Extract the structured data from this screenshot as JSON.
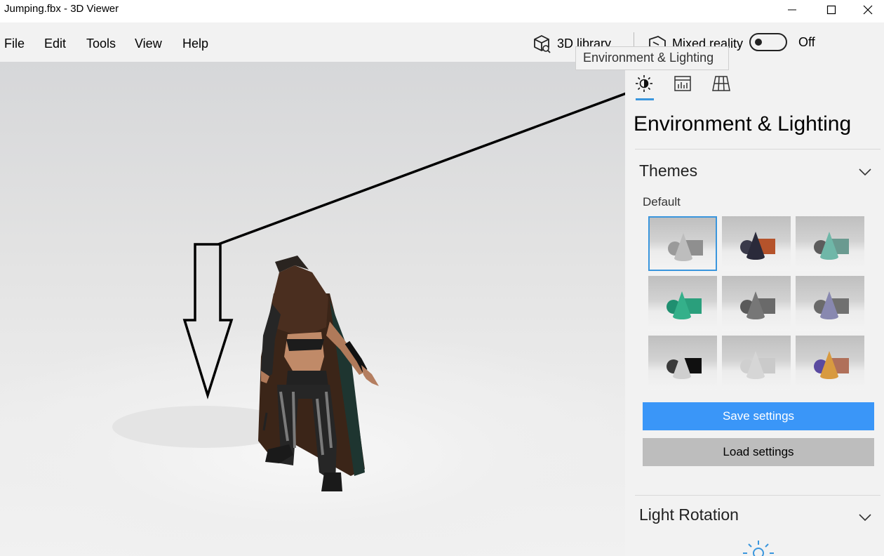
{
  "window": {
    "title": "Jumping.fbx - 3D Viewer"
  },
  "menu": [
    "File",
    "Edit",
    "Tools",
    "View",
    "Help"
  ],
  "toolbar": {
    "library_label": "3D library",
    "mixed_reality_label": "Mixed reality",
    "mixed_reality_state": "Off"
  },
  "tooltip": "Environment & Lighting",
  "panel": {
    "title": "Environment & Lighting",
    "themes": {
      "heading": "Themes",
      "group_label": "Default",
      "selected_index": 0,
      "thumbnails": [
        {
          "sphere": "#9a9a9a",
          "cone": "#bdbdbd",
          "box": "#8f8f8f"
        },
        {
          "sphere": "#3a3a4a",
          "cone": "#2a2a3a",
          "box": "#b5532b"
        },
        {
          "sphere": "#5c5c5c",
          "cone": "#6fb7a8",
          "box": "#6a9a90"
        },
        {
          "sphere": "#1f8f70",
          "cone": "#34b08a",
          "box": "#2a9f7c"
        },
        {
          "sphere": "#5a5a5a",
          "cone": "#777777",
          "box": "#6a6a6a"
        },
        {
          "sphere": "#6a6a6a",
          "cone": "#8888b0",
          "box": "#707070"
        },
        {
          "sphere": "#3a3a3a",
          "cone": "#cfcfcf",
          "box": "#101010"
        },
        {
          "sphere": "#cfcfcf",
          "cone": "#d6d6d6",
          "box": "#cacaca"
        },
        {
          "sphere": "#5a4aa0",
          "cone": "#d89a40",
          "box": "#b0705a"
        }
      ]
    },
    "save_label": "Save settings",
    "load_label": "Load settings",
    "light_rotation": {
      "heading": "Light Rotation"
    }
  },
  "colors": {
    "accent": "#3a96dd",
    "save_button": "#3a96f8",
    "load_button": "#bdbdbd",
    "panel_bg": "#f2f2f2"
  }
}
